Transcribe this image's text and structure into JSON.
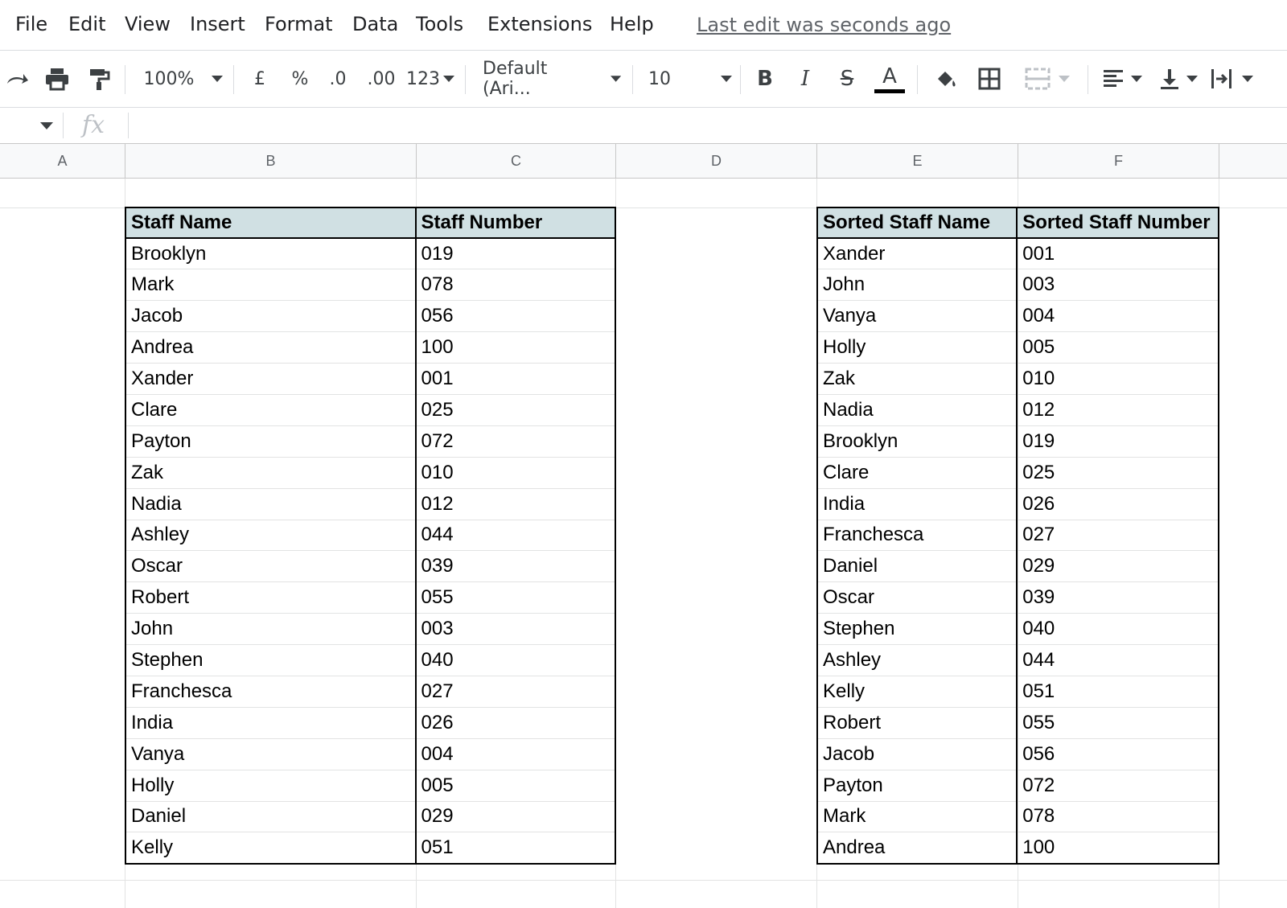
{
  "menu": {
    "items": [
      "File",
      "Edit",
      "View",
      "Insert",
      "Format",
      "Data",
      "Tools",
      "Extensions",
      "Help"
    ],
    "last_edit": "Last edit was seconds ago"
  },
  "toolbar": {
    "zoom": "100%",
    "currency": "£",
    "percent": "%",
    "decrease_decimal": ".0",
    "increase_decimal": ".00",
    "number_format": "123",
    "font": "Default (Ari...",
    "font_size": "10",
    "bold": "B",
    "italic": "I",
    "strikethrough": "S",
    "text_color": "A"
  },
  "formula_bar": {
    "fx": "fx",
    "value": ""
  },
  "columns": [
    "A",
    "B",
    "C",
    "D",
    "E",
    "F"
  ],
  "original_table": {
    "headers": [
      "Staff Name",
      "Staff Number"
    ],
    "rows": [
      [
        "Brooklyn",
        "019"
      ],
      [
        "Mark",
        "078"
      ],
      [
        "Jacob",
        "056"
      ],
      [
        "Andrea",
        "100"
      ],
      [
        "Xander",
        "001"
      ],
      [
        "Clare",
        "025"
      ],
      [
        "Payton",
        "072"
      ],
      [
        "Zak",
        "010"
      ],
      [
        "Nadia",
        "012"
      ],
      [
        "Ashley",
        "044"
      ],
      [
        "Oscar",
        "039"
      ],
      [
        "Robert",
        "055"
      ],
      [
        "John",
        "003"
      ],
      [
        "Stephen",
        "040"
      ],
      [
        "Franchesca",
        "027"
      ],
      [
        "India",
        "026"
      ],
      [
        "Vanya",
        "004"
      ],
      [
        "Holly",
        "005"
      ],
      [
        "Daniel",
        "029"
      ],
      [
        "Kelly",
        "051"
      ]
    ]
  },
  "sorted_table": {
    "headers": [
      "Sorted Staff Name",
      "Sorted Staff Number"
    ],
    "rows": [
      [
        "Xander",
        "001"
      ],
      [
        "John",
        "003"
      ],
      [
        "Vanya",
        "004"
      ],
      [
        "Holly",
        "005"
      ],
      [
        "Zak",
        "010"
      ],
      [
        "Nadia",
        "012"
      ],
      [
        "Brooklyn",
        "019"
      ],
      [
        "Clare",
        "025"
      ],
      [
        "India",
        "026"
      ],
      [
        "Franchesca",
        "027"
      ],
      [
        "Daniel",
        "029"
      ],
      [
        "Oscar",
        "039"
      ],
      [
        "Stephen",
        "040"
      ],
      [
        "Ashley",
        "044"
      ],
      [
        "Kelly",
        "051"
      ],
      [
        "Robert",
        "055"
      ],
      [
        "Jacob",
        "056"
      ],
      [
        "Payton",
        "072"
      ],
      [
        "Mark",
        "078"
      ],
      [
        "Andrea",
        "100"
      ]
    ]
  },
  "colors": {
    "header_fill": "#d0e0e3",
    "gridline": "#e2e3e3",
    "border": "#000000"
  }
}
